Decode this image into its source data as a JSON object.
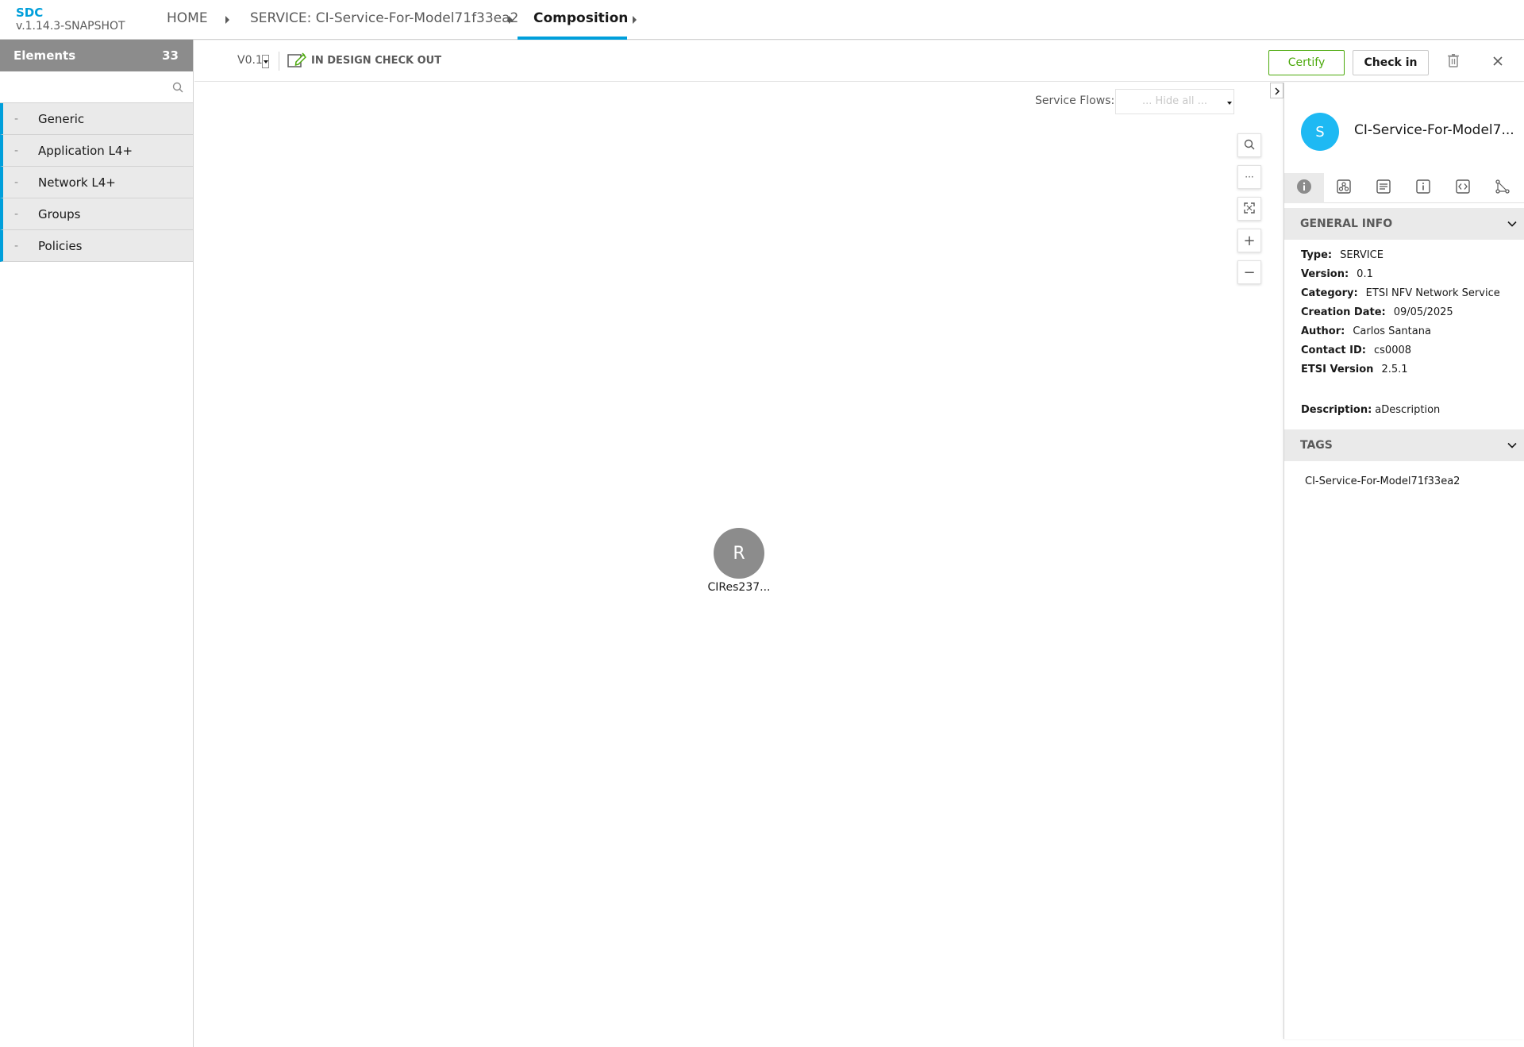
{
  "app": {
    "name": "SDC",
    "version": "v.1.14.3-SNAPSHOT"
  },
  "breadcrumbs": [
    {
      "label": "HOME"
    },
    {
      "label": "SERVICE: CI-Service-For-Model71f33ea2"
    },
    {
      "label": "Composition"
    }
  ],
  "palette": {
    "title": "Elements",
    "count": "33",
    "search_placeholder": "",
    "groups": [
      {
        "dash": "-",
        "label": "Generic"
      },
      {
        "dash": "-",
        "label": "Application L4+"
      },
      {
        "dash": "-",
        "label": "Network L4+"
      },
      {
        "dash": "-",
        "label": "Groups"
      },
      {
        "dash": "-",
        "label": "Policies"
      }
    ]
  },
  "toolbar": {
    "version": "V0.1",
    "status": "IN DESIGN CHECK OUT",
    "certify_label": "Certify",
    "checkin_label": "Check in",
    "icons": [
      "checkout-edit-icon",
      "trash-icon",
      "close-icon"
    ]
  },
  "canvas": {
    "flows_label": "Service Flows:",
    "flows_value": "... Hide all ...",
    "zoom_icons": [
      "search-icon",
      "more-icon",
      "fit-icon",
      "zoom-in-icon",
      "zoom-out-icon"
    ],
    "zoom_glyphs": [
      "",
      "···",
      "",
      "+",
      "−"
    ],
    "node": {
      "letter": "R",
      "label": "CIRes237..."
    }
  },
  "right_panel": {
    "avatar_letter": "S",
    "title": "CI-Service-For-Model7...",
    "tabs": [
      "info-icon",
      "composition-icon",
      "deployment-icon",
      "properties-icon",
      "api-icon",
      "paths-icon"
    ],
    "general_info": {
      "heading": "GENERAL INFO",
      "rows": [
        {
          "key": "Type:",
          "value": "SERVICE"
        },
        {
          "key": "Version:",
          "value": "0.1"
        },
        {
          "key": "Category:",
          "value": "ETSI NFV Network Service"
        },
        {
          "key": "Creation Date:",
          "value": "09/05/2025"
        },
        {
          "key": "Author:",
          "value": "Carlos Santana"
        },
        {
          "key": "Contact ID:",
          "value": "cs0008"
        },
        {
          "key": "ETSI Version",
          "value": "2.5.1"
        }
      ],
      "description_key": "Description:",
      "description_value": "aDescription"
    },
    "tags": {
      "heading": "TAGS",
      "items": [
        "CI-Service-For-Model71f33ea2"
      ]
    }
  },
  "colors": {
    "accent": "#009fdb",
    "certify": "#4ca90c",
    "avatar": "#1eb9f3",
    "node": "#8c8c8c",
    "palette_header": "#8c8c8c"
  }
}
